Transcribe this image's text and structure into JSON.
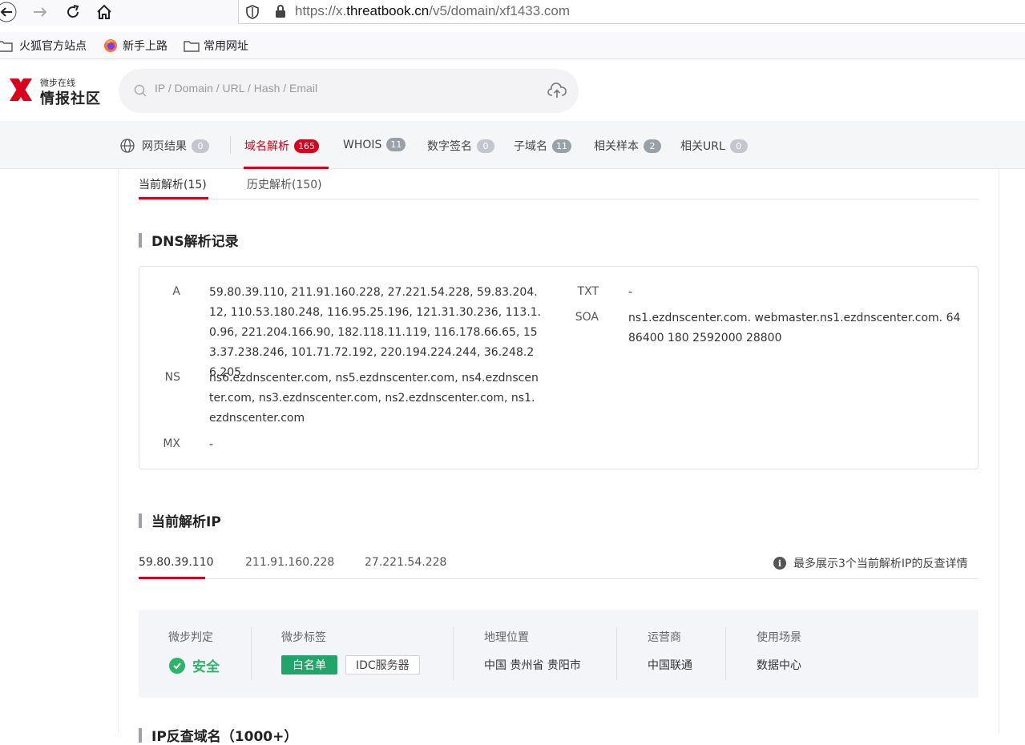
{
  "browser": {
    "url_prefix": "https://x.",
    "url_domain": "threatbook.cn",
    "url_path": "/v5/domain/xf1433.com",
    "bookmarks": [
      {
        "label": "火狐官方站点"
      },
      {
        "label": "新手上路"
      },
      {
        "label": "常用网址"
      }
    ]
  },
  "header": {
    "logo_small": "微步在线",
    "logo_big": "情报社区",
    "search_placeholder": "IP / Domain / URL / Hash / Email"
  },
  "tabs": [
    {
      "label": "网页结果",
      "count": "0"
    },
    {
      "label": "域名解析",
      "count": "165"
    },
    {
      "label": "WHOIS",
      "count": "11"
    },
    {
      "label": "数字签名",
      "count": "0"
    },
    {
      "label": "子域名",
      "count": "11"
    },
    {
      "label": "相关样本",
      "count": "2"
    },
    {
      "label": "相关URL",
      "count": "0"
    }
  ],
  "subtabs": {
    "current": "当前解析(15)",
    "history": "历史解析(150)"
  },
  "dns_section": {
    "title": "DNS解析记录",
    "records": {
      "a_label": "A",
      "a_value": "59.80.39.110, 211.91.160.228, 27.221.54.228, 59.83.204.12, 110.53.180.248, 116.95.25.196, 121.31.30.236, 113.1.0.96, 221.204.166.90, 182.118.11.119, 116.178.66.65, 153.37.238.246, 101.71.72.192, 220.194.224.244, 36.248.26.205",
      "ns_label": "NS",
      "ns_value": "ns6.ezdnscenter.com, ns5.ezdnscenter.com, ns4.ezdnscenter.com, ns3.ezdnscenter.com, ns2.ezdnscenter.com, ns1.ezdnscenter.com",
      "mx_label": "MX",
      "mx_value": "-",
      "txt_label": "TXT",
      "txt_value": "-",
      "soa_label": "SOA",
      "soa_value": "ns1.ezdnscenter.com. webmaster.ns1.ezdnscenter.com. 64 86400 180 2592000 28800"
    }
  },
  "ip_section": {
    "title": "当前解析IP",
    "ip_tabs": [
      "59.80.39.110",
      "211.91.160.228",
      "27.221.54.228"
    ],
    "note": "最多展示3个当前解析IP的反查详情",
    "detail": {
      "judgement_label": "微步判定",
      "judgement_value": "安全",
      "tags_label": "微步标签",
      "tag1": "白名单",
      "tag2": "IDC服务器",
      "geo_label": "地理位置",
      "geo_value": "中国 贵州省 贵阳市",
      "isp_label": "运营商",
      "isp_value": "中国联通",
      "scene_label": "使用场景",
      "scene_value": "数据中心"
    }
  },
  "bottom_section": {
    "title": "IP反查域名（1000+）"
  },
  "colors": {
    "accent": "#d9001b",
    "safe": "#2db36a",
    "tag_green": "#22a56a"
  }
}
